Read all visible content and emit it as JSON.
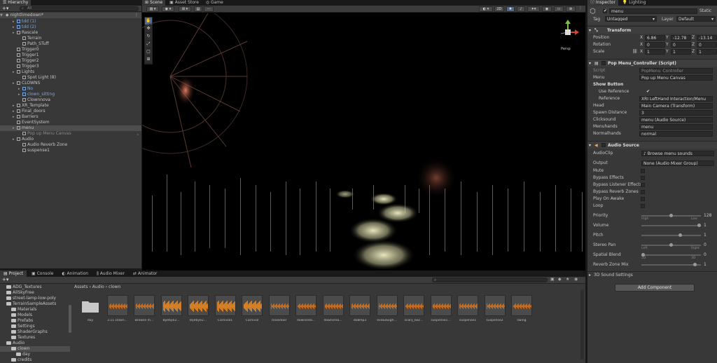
{
  "hierarchy": {
    "tab": "Hierarchy",
    "search_placeholder": "All",
    "scene": "nightlimedown*",
    "rows": [
      {
        "label": "tdd (1)",
        "style": "blue"
      },
      {
        "label": "tdd (2)",
        "style": "blue"
      },
      {
        "label": "Rascale",
        "style": "normal"
      },
      {
        "label": "Terrain",
        "style": "normal"
      },
      {
        "label": "Path_STuff",
        "style": "normal"
      },
      {
        "label": "Trigger0",
        "style": "normal"
      },
      {
        "label": "Trigger1",
        "style": "normal"
      },
      {
        "label": "Trigger2",
        "style": "normal"
      },
      {
        "label": "Trigger3",
        "style": "normal"
      },
      {
        "label": "Lights",
        "style": "normal"
      },
      {
        "label": "Spot Light (8)",
        "style": "normal"
      },
      {
        "label": "CLOWNS",
        "style": "normal"
      },
      {
        "label": "No",
        "style": "blue"
      },
      {
        "label": "clown_sitting",
        "style": "blue"
      },
      {
        "label": "Clownnova",
        "style": "normal"
      },
      {
        "label": "XR_Template",
        "style": "normal"
      },
      {
        "label": "Final_doors",
        "style": "normal"
      },
      {
        "label": "Barriers",
        "style": "normal"
      },
      {
        "label": "EventSystem",
        "style": "normal"
      },
      {
        "label": "menu",
        "style": "selected"
      },
      {
        "label": "Pop up Menu Canvas",
        "style": "dim"
      },
      {
        "label": "Audio",
        "style": "normal"
      },
      {
        "label": "Audio Reverb Zone",
        "style": "normal"
      },
      {
        "label": "suspense1",
        "style": "normal"
      }
    ]
  },
  "scene_view": {
    "tabs": [
      "Scene",
      "Asset Store",
      "Game"
    ],
    "toolbar_2d": "2D",
    "gizmo_label": "Persp"
  },
  "inspector": {
    "tabs": [
      "Inspector",
      "Lighting"
    ],
    "object_name": "menu",
    "static_label": "Static",
    "tag_label": "Tag",
    "tag_value": "Untagged",
    "layer_label": "Layer",
    "layer_value": "Default",
    "transform": {
      "title": "Transform",
      "position_label": "Position",
      "rotation_label": "Rotation",
      "scale_label": "Scale",
      "position": [
        "6.86",
        "-12.78",
        "-13.14"
      ],
      "rotation": [
        "0",
        "0",
        "0"
      ],
      "scale": [
        "1",
        "1",
        "1"
      ]
    },
    "script_comp": {
      "title": "Pop Menu_Controller (Script)",
      "rows": [
        {
          "label": "Script",
          "value": "PopMenu_Controller",
          "dim": true
        },
        {
          "label": "Menu",
          "value": "Pop up Menu Canvas"
        },
        {
          "label": "Show Button",
          "value": "",
          "bold": true
        },
        {
          "label": "Use Reference",
          "value": "✔",
          "indent": true
        },
        {
          "label": "Reference",
          "value": "XRI LeftHand Interaction/Menu",
          "indent": true
        },
        {
          "label": "Head",
          "value": "Main Camera (Transform)"
        },
        {
          "label": "Spawn Distance",
          "value": "3"
        },
        {
          "label": "Clicksound",
          "value": "menu (Audio Source)"
        },
        {
          "label": "Menuhands",
          "value": "menu"
        },
        {
          "label": "Normalhands",
          "value": "normal"
        }
      ]
    },
    "audio": {
      "title": "Audio Source",
      "clip_label": "AudioClip",
      "clip_value": "Browse menu sounds",
      "output_label": "Output",
      "output_value": "None (Audio Mixer Group)",
      "toggles": [
        "Mute",
        "Bypass Effects",
        "Bypass Listener Effects",
        "Bypass Reverb Zones",
        "Play On Awake",
        "Loop"
      ],
      "sliders": [
        {
          "label": "Priority",
          "value": "128",
          "fraction": 0.5,
          "min": "High",
          "max": "Low"
        },
        {
          "label": "Volume",
          "value": "1",
          "fraction": 1.0
        },
        {
          "label": "Pitch",
          "value": "1",
          "fraction": 0.66
        },
        {
          "label": "Stereo Pan",
          "value": "0",
          "fraction": 0.5,
          "min": "Left",
          "max": "Right"
        },
        {
          "label": "Spatial Blend",
          "value": "0",
          "fraction": 0.0,
          "min": "2D",
          "max": "3D"
        },
        {
          "label": "Reverb Zone Mix",
          "value": "1",
          "fraction": 0.92
        }
      ],
      "sound3d": "3D Sound Settings"
    },
    "add_component": "Add Component"
  },
  "project": {
    "tabs": [
      "Project",
      "Console",
      "Animation",
      "Audio Mixer",
      "Animator"
    ],
    "breadcrumb": [
      "Assets",
      "Audio",
      "clown"
    ],
    "tree": [
      {
        "label": "ADG_Textures",
        "indent": 1,
        "sel": false
      },
      {
        "label": "AllSkyFree",
        "indent": 1,
        "sel": false
      },
      {
        "label": "street-lamp-low-poly",
        "indent": 1,
        "sel": false
      },
      {
        "label": "TerrainSampleAssets",
        "indent": 1,
        "sel": false
      },
      {
        "label": "Materials",
        "indent": 2,
        "sel": false
      },
      {
        "label": "Models",
        "indent": 2,
        "sel": false
      },
      {
        "label": "Prefabs",
        "indent": 2,
        "sel": false
      },
      {
        "label": "Settings",
        "indent": 2,
        "sel": false
      },
      {
        "label": "ShaderGraphs",
        "indent": 2,
        "sel": false
      },
      {
        "label": "Textures",
        "indent": 2,
        "sel": false
      },
      {
        "label": "Audio",
        "indent": 1,
        "sel": false
      },
      {
        "label": "clown",
        "indent": 2,
        "sel": true
      },
      {
        "label": "day",
        "indent": 3,
        "sel": false
      },
      {
        "label": "credits",
        "indent": 2,
        "sel": false
      }
    ],
    "assets": [
      {
        "label": "day",
        "type": "folder",
        "bright": false
      },
      {
        "label": "3.11 clown...",
        "type": "audio",
        "bright": false
      },
      {
        "label": "Browse m...",
        "type": "audio",
        "bright": false
      },
      {
        "label": "Byebye2...",
        "type": "audio",
        "bright": true
      },
      {
        "label": "Byebye2...",
        "type": "audio",
        "bright": true
      },
      {
        "label": "Carnival1",
        "type": "audio",
        "bright": true
      },
      {
        "label": "Carnival",
        "type": "audio",
        "bright": true
      },
      {
        "label": "closedoor",
        "type": "audio",
        "bright": false
      },
      {
        "label": "downsrea...",
        "type": "audio",
        "bright": false
      },
      {
        "label": "downsrea...",
        "type": "audio",
        "bright": false
      },
      {
        "label": "do8mp3",
        "type": "audio",
        "bright": false
      },
      {
        "label": "evil&laugh...",
        "type": "audio",
        "bright": false
      },
      {
        "label": "scary_bac...",
        "type": "audio",
        "bright": false
      },
      {
        "label": "suspense1...",
        "type": "audio",
        "bright": false
      },
      {
        "label": "suspense1",
        "type": "audio",
        "bright": false
      },
      {
        "label": "suspense2",
        "type": "audio",
        "bright": false
      },
      {
        "label": "swing",
        "type": "audio",
        "bright": false
      }
    ]
  }
}
